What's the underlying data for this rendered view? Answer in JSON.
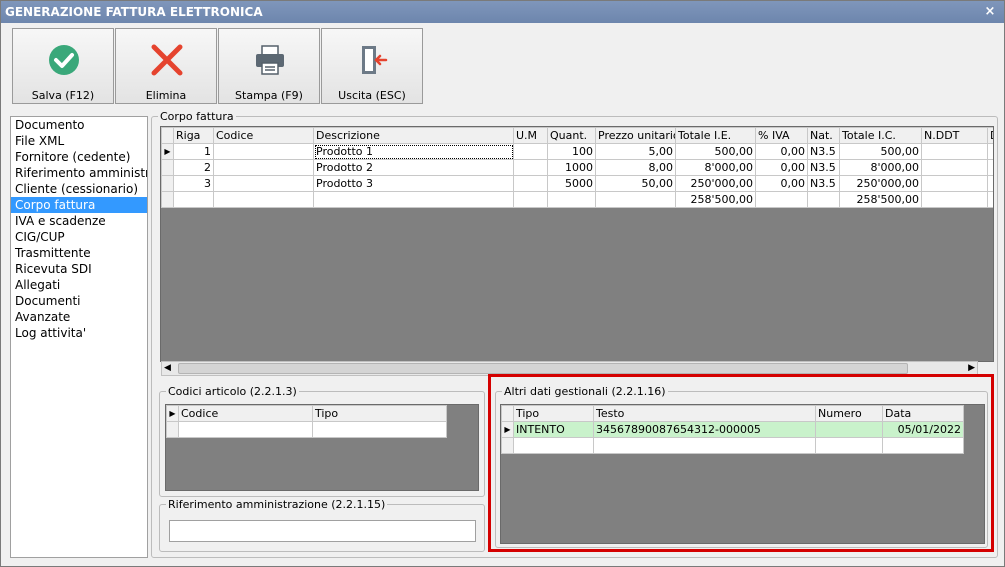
{
  "window": {
    "title": "GENERAZIONE FATTURA ELETTRONICA",
    "close_glyph": "×"
  },
  "toolbar": {
    "save_label": "Salva (F12)",
    "delete_label": "Elimina",
    "print_label": "Stampa (F9)",
    "exit_label": "Uscita (ESC)"
  },
  "nav": {
    "items": [
      {
        "label": "Documento"
      },
      {
        "label": "File XML"
      },
      {
        "label": "Fornitore (cedente)"
      },
      {
        "label": "Riferimento amministra"
      },
      {
        "label": "Cliente (cessionario)"
      },
      {
        "label": "Corpo fattura",
        "selected": true
      },
      {
        "label": "IVA e scadenze"
      },
      {
        "label": "CIG/CUP"
      },
      {
        "label": "Trasmittente"
      },
      {
        "label": "Ricevuta SDI"
      },
      {
        "label": "Allegati"
      },
      {
        "label": "Documenti"
      },
      {
        "label": "Avanzate"
      },
      {
        "label": "Log attivita'"
      }
    ]
  },
  "corpo": {
    "legend": "Corpo fattura",
    "columns": [
      "Riga",
      "Codice",
      "Descrizione",
      "U.M",
      "Quant.",
      "Prezzo unitario",
      "Totale I.E.",
      "% IVA",
      "Nat.",
      "Totale I.C.",
      "N.DDT",
      "D"
    ],
    "rows": [
      {
        "riga": "1",
        "codice": "",
        "descrizione": "Prodotto 1",
        "um": "",
        "quant": "100",
        "prezzo": "5,00",
        "tot_ie": "500,00",
        "iva": "0,00",
        "nat": "N3.5",
        "tot_ic": "500,00",
        "nddt": ""
      },
      {
        "riga": "2",
        "codice": "",
        "descrizione": "Prodotto 2",
        "um": "",
        "quant": "1000",
        "prezzo": "8,00",
        "tot_ie": "8'000,00",
        "iva": "0,00",
        "nat": "N3.5",
        "tot_ic": "8'000,00",
        "nddt": ""
      },
      {
        "riga": "3",
        "codice": "",
        "descrizione": "Prodotto 3",
        "um": "",
        "quant": "5000",
        "prezzo": "50,00",
        "tot_ie": "250'000,00",
        "iva": "0,00",
        "nat": "N3.5",
        "tot_ic": "250'000,00",
        "nddt": ""
      }
    ],
    "totals": {
      "tot_ie": "258'500,00",
      "tot_ic": "258'500,00"
    }
  },
  "codici": {
    "legend": "Codici articolo (2.2.1.3)",
    "columns": [
      "Codice",
      "Tipo"
    ]
  },
  "rif_amm": {
    "legend": "Riferimento amministrazione (2.2.1.15)",
    "value": ""
  },
  "altri": {
    "legend": "Altri dati gestionali (2.2.1.16)",
    "columns": [
      "Tipo",
      "Testo",
      "Numero",
      "Data"
    ],
    "rows": [
      {
        "tipo": "INTENTO",
        "testo": "34567890087654312-000005",
        "numero": "",
        "data": "05/01/2022"
      }
    ]
  },
  "colors": {
    "titlebar": "#7289b2",
    "selection": "#3399ff",
    "highlight": "#d40000",
    "row_green": "#c9f2cb"
  }
}
